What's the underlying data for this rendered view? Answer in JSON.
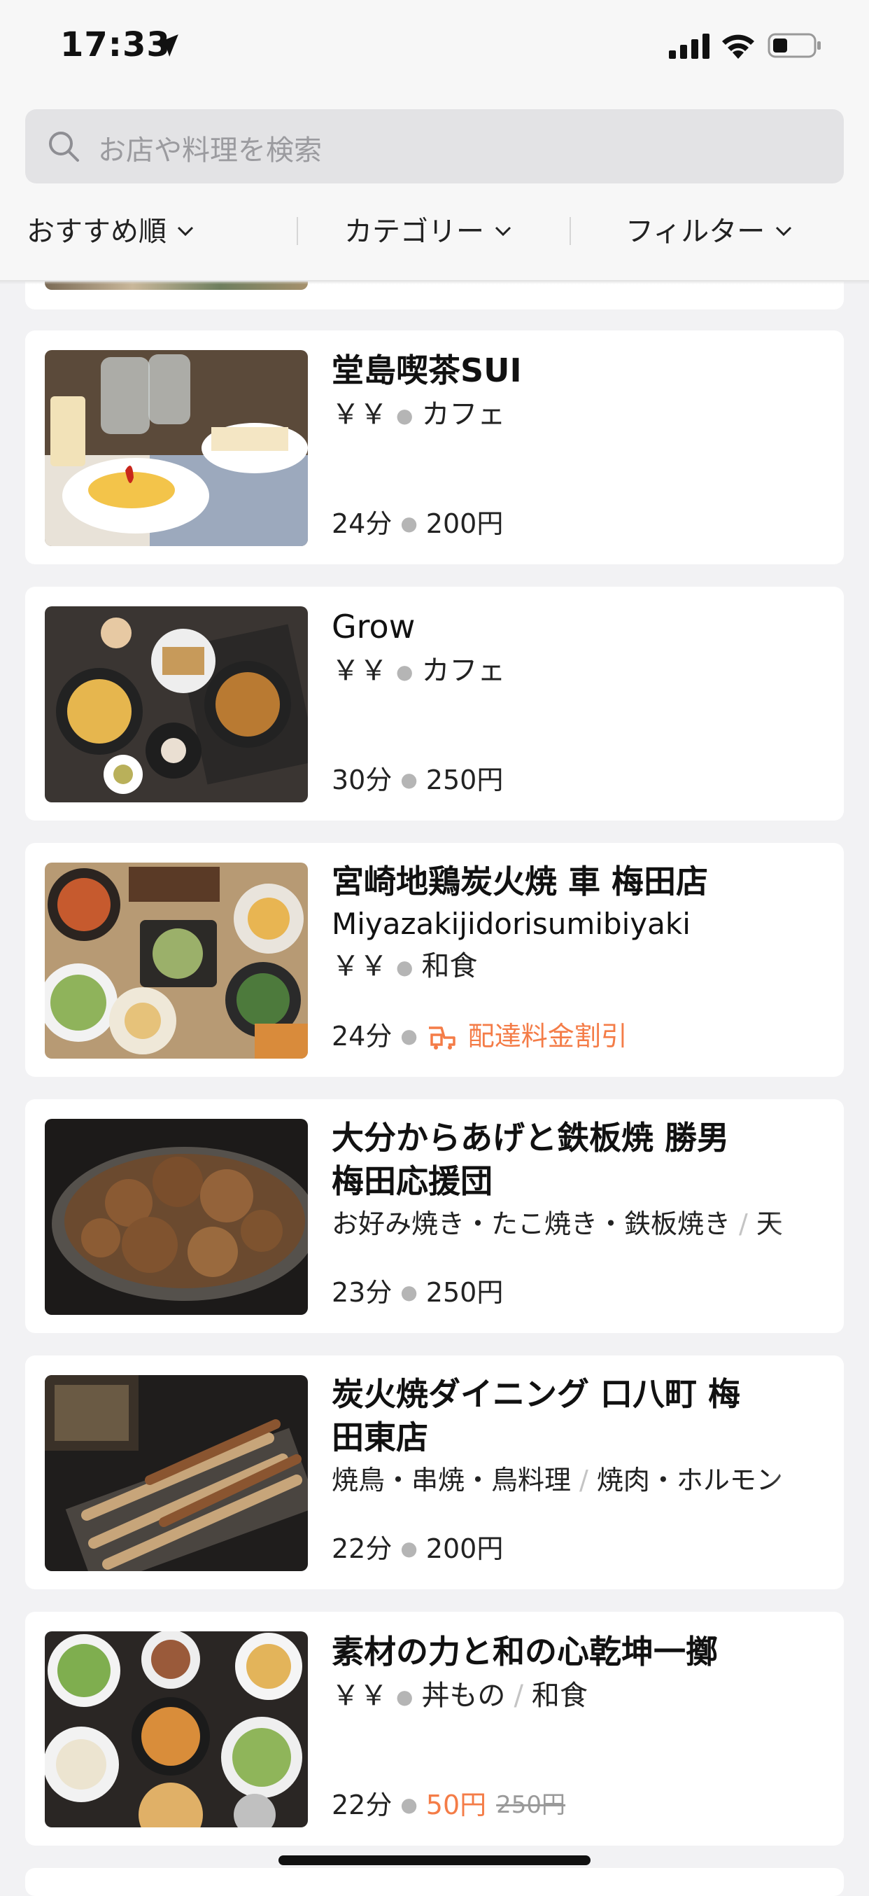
{
  "status_bar": {
    "time": "17:33"
  },
  "search": {
    "placeholder": "お店や料理を検索"
  },
  "filters": {
    "sort": "おすすめ順",
    "category": "カテゴリー",
    "filter": "フィルター"
  },
  "colors": {
    "accent": "#f47c47",
    "background": "#f2f2f4",
    "card": "#ffffff"
  },
  "restaurants": [
    {
      "name": "堂島喫茶SUI",
      "price": "￥￥",
      "cuisine": "カフェ",
      "time": "24分",
      "fee": "200円"
    },
    {
      "name": "Grow",
      "price": "￥￥",
      "cuisine": "カフェ",
      "time": "30分",
      "fee": "250円"
    },
    {
      "name": "宮崎地鶏炭火焼 車 梅田店",
      "name_en": "Miyazakijidorisumibiyaki",
      "price": "￥￥",
      "cuisine": "和食",
      "time": "24分",
      "promo": "配達料金割引"
    },
    {
      "name_line1": "大分からあげと鉄板焼 勝男",
      "name_line2": "梅田応援団",
      "cuisine": "お好み焼き・たこ焼き・鉄板焼き",
      "cuisine2": "天",
      "time": "23分",
      "fee": "250円"
    },
    {
      "name_line1": "炭火焼ダイニング 口八町 梅",
      "name_line2": "田東店",
      "cuisine": "焼鳥・串焼・鳥料理",
      "cuisine2": "焼肉・ホルモン",
      "time": "22分",
      "fee": "200円"
    },
    {
      "name": "素材の力と和の心乾坤一擲",
      "price": "￥￥",
      "cuisine": "丼もの",
      "cuisine2": "和食",
      "time": "22分",
      "fee_discounted": "50円",
      "fee_original": "250円"
    }
  ]
}
